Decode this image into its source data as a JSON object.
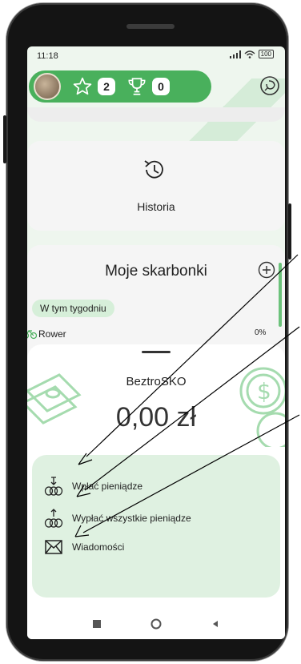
{
  "status_bar": {
    "time": "11:18",
    "battery": "100"
  },
  "top_bar": {
    "stars_count": "2",
    "trophies_count": "0"
  },
  "historia": {
    "label": "Historia"
  },
  "piggy_banks": {
    "title": "Moje skarbonki",
    "filter_chip": "W tym tygodniu",
    "items": [
      {
        "name": "Rower",
        "progress": "0%"
      }
    ]
  },
  "sheet": {
    "account_name": "BeztroSKO",
    "balance": "0,00 zł",
    "actions": [
      {
        "label": "Wpłać pieniądze",
        "icon": "coins-in-icon"
      },
      {
        "label": "Wypłać wszystkie pieniądze",
        "icon": "coins-out-icon"
      },
      {
        "label": "Wiadomości",
        "icon": "envelope-icon"
      }
    ]
  },
  "colors": {
    "accent": "#49b05c",
    "action_panel": "#dff1e1",
    "screen_bg": "#eef6ee"
  }
}
